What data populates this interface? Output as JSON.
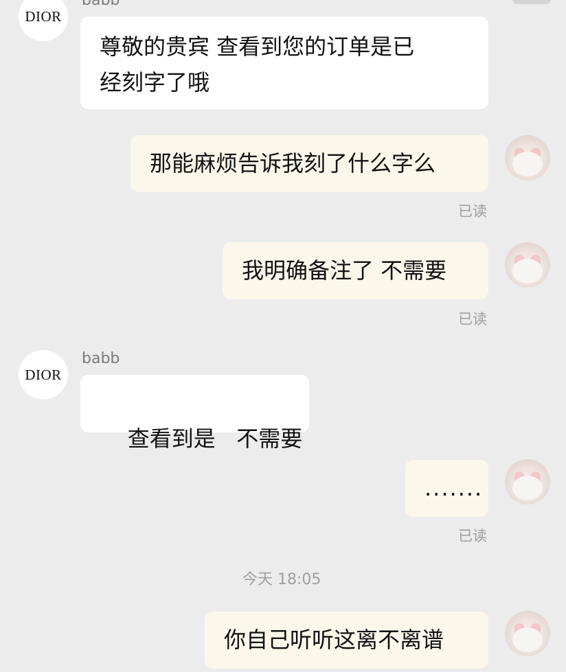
{
  "messages": [
    {
      "side": "in",
      "sender": "babb",
      "avatar_text": "DIOR",
      "text": "尊敬的贵宾 查看到您的订单是已经刻字了哦"
    },
    {
      "side": "out",
      "text": "那能麻烦告诉我刻了什么字么",
      "status": "已读"
    },
    {
      "side": "out",
      "text": "我明确备注了 不需要",
      "status": "已读"
    },
    {
      "side": "in",
      "sender": "babb",
      "avatar_text": "DIOR",
      "text": "查看到是   不需要"
    },
    {
      "side": "out",
      "text": ".......",
      "status": "已读"
    },
    {
      "side": "out",
      "text": "你自己听听这离不离谱"
    }
  ],
  "timestamp": "今天 18:05",
  "message_1_lines": [
    "尊敬的贵宾 查看到您的订单是已",
    "经刻字了哦"
  ]
}
